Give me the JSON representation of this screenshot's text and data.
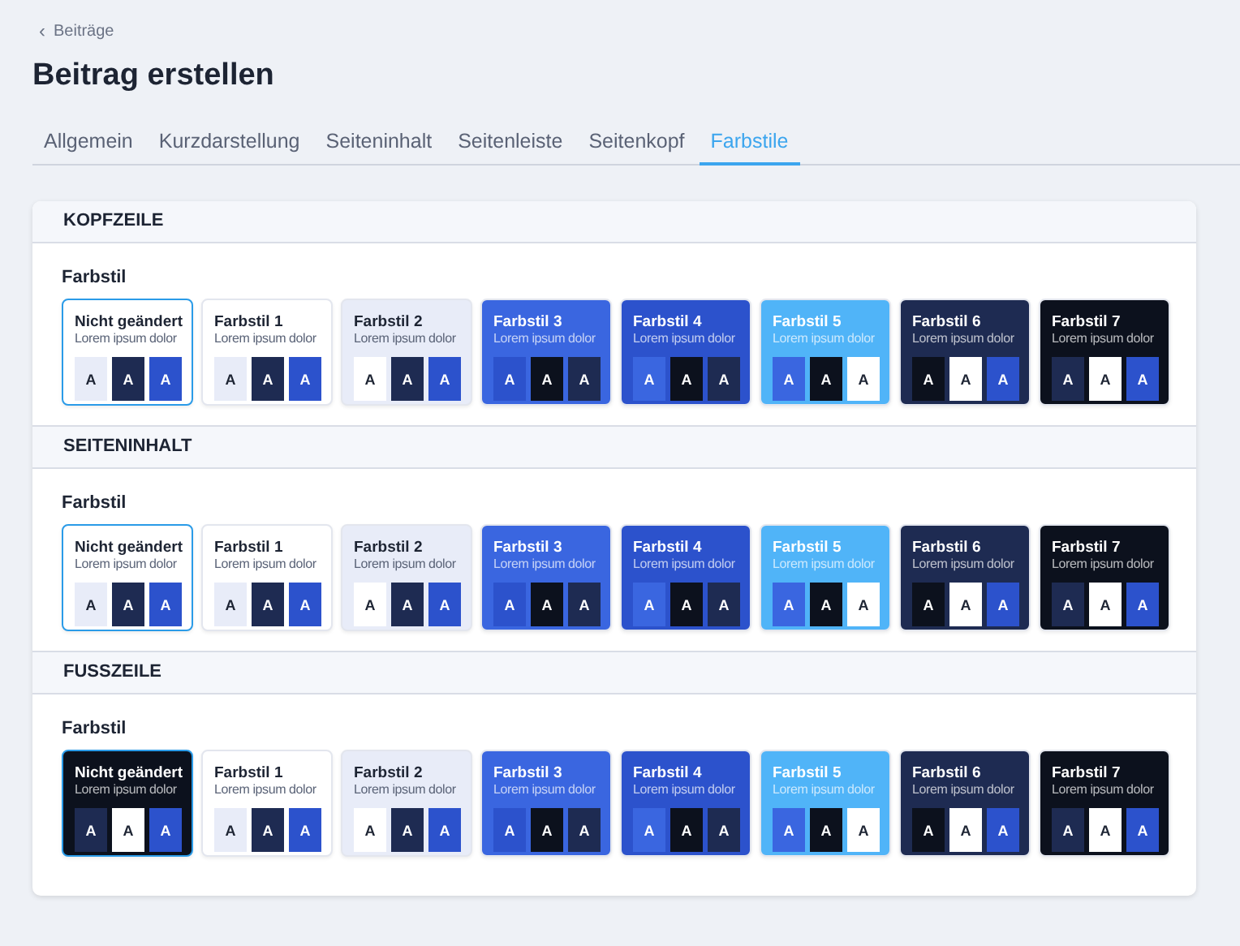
{
  "breadcrumb": {
    "icon": "‹",
    "label": "Beiträge"
  },
  "title": "Beitrag erstellen",
  "tabs": [
    {
      "label": "Allgemein",
      "selected": false
    },
    {
      "label": "Kurzdarstellung",
      "selected": false
    },
    {
      "label": "Seiteninhalt",
      "selected": false
    },
    {
      "label": "Seitenleiste",
      "selected": false
    },
    {
      "label": "Seitenkopf",
      "selected": false
    },
    {
      "label": "Farbstile",
      "selected": true
    }
  ],
  "sections": [
    {
      "title": "KOPFZEILE",
      "field_label": "Farbstil",
      "styles": [
        {
          "name": "Nicht geändert",
          "subtitle": "Lorem ipsum dolor",
          "color": "#ffffff",
          "selected": true,
          "swatches": [
            {
              "label": "A",
              "color": "#e8ecf8"
            },
            {
              "label": "A",
              "color": "#1e2b52"
            },
            {
              "label": "A",
              "color": "#2c52cc"
            }
          ]
        },
        {
          "name": "Farbstil 1",
          "subtitle": "Lorem ipsum dolor",
          "color": "#ffffff",
          "selected": false,
          "swatches": [
            {
              "label": "A",
              "color": "#e8ecf8"
            },
            {
              "label": "A",
              "color": "#1e2b52"
            },
            {
              "label": "A",
              "color": "#2c52cc"
            }
          ]
        },
        {
          "name": "Farbstil 2",
          "subtitle": "Lorem ipsum dolor",
          "color": "#e8ecf8",
          "selected": false,
          "swatches": [
            {
              "label": "A",
              "color": "#ffffff"
            },
            {
              "label": "A",
              "color": "#1e2b52"
            },
            {
              "label": "A",
              "color": "#2c52cc"
            }
          ]
        },
        {
          "name": "Farbstil 3",
          "subtitle": "Lorem ipsum dolor",
          "color": "#3a66e0",
          "selected": false,
          "swatches": [
            {
              "label": "A",
              "color": "#2c52cc"
            },
            {
              "label": "A",
              "color": "#0c111d"
            },
            {
              "label": "A",
              "color": "#1e2b52"
            }
          ]
        },
        {
          "name": "Farbstil 4",
          "subtitle": "Lorem ipsum dolor",
          "color": "#2c52cc",
          "selected": false,
          "swatches": [
            {
              "label": "A",
              "color": "#3a66e0"
            },
            {
              "label": "A",
              "color": "#0c111d"
            },
            {
              "label": "A",
              "color": "#1e2b52"
            }
          ]
        },
        {
          "name": "Farbstil 5",
          "subtitle": "Lorem ipsum dolor",
          "color": "#50b4f8",
          "selected": false,
          "swatches": [
            {
              "label": "A",
              "color": "#3a66e0"
            },
            {
              "label": "A",
              "color": "#0c111d"
            },
            {
              "label": "A",
              "color": "#ffffff"
            }
          ]
        },
        {
          "name": "Farbstil 6",
          "subtitle": "Lorem ipsum dolor",
          "color": "#1e2b52",
          "selected": false,
          "swatches": [
            {
              "label": "A",
              "color": "#0c111d"
            },
            {
              "label": "A",
              "color": "#ffffff"
            },
            {
              "label": "A",
              "color": "#2c52cc"
            }
          ]
        },
        {
          "name": "Farbstil 7",
          "subtitle": "Lorem ipsum dolor",
          "color": "#0c111d",
          "selected": false,
          "swatches": [
            {
              "label": "A",
              "color": "#1e2b52"
            },
            {
              "label": "A",
              "color": "#ffffff"
            },
            {
              "label": "A",
              "color": "#2c52cc"
            }
          ]
        }
      ]
    },
    {
      "title": "SEITENINHALT",
      "field_label": "Farbstil",
      "styles": [
        {
          "name": "Nicht geändert",
          "subtitle": "Lorem ipsum dolor",
          "color": "#ffffff",
          "selected": true,
          "swatches": [
            {
              "label": "A",
              "color": "#e8ecf8"
            },
            {
              "label": "A",
              "color": "#1e2b52"
            },
            {
              "label": "A",
              "color": "#2c52cc"
            }
          ]
        },
        {
          "name": "Farbstil 1",
          "subtitle": "Lorem ipsum dolor",
          "color": "#ffffff",
          "selected": false,
          "swatches": [
            {
              "label": "A",
              "color": "#e8ecf8"
            },
            {
              "label": "A",
              "color": "#1e2b52"
            },
            {
              "label": "A",
              "color": "#2c52cc"
            }
          ]
        },
        {
          "name": "Farbstil 2",
          "subtitle": "Lorem ipsum dolor",
          "color": "#e8ecf8",
          "selected": false,
          "swatches": [
            {
              "label": "A",
              "color": "#ffffff"
            },
            {
              "label": "A",
              "color": "#1e2b52"
            },
            {
              "label": "A",
              "color": "#2c52cc"
            }
          ]
        },
        {
          "name": "Farbstil 3",
          "subtitle": "Lorem ipsum dolor",
          "color": "#3a66e0",
          "selected": false,
          "swatches": [
            {
              "label": "A",
              "color": "#2c52cc"
            },
            {
              "label": "A",
              "color": "#0c111d"
            },
            {
              "label": "A",
              "color": "#1e2b52"
            }
          ]
        },
        {
          "name": "Farbstil 4",
          "subtitle": "Lorem ipsum dolor",
          "color": "#2c52cc",
          "selected": false,
          "swatches": [
            {
              "label": "A",
              "color": "#3a66e0"
            },
            {
              "label": "A",
              "color": "#0c111d"
            },
            {
              "label": "A",
              "color": "#1e2b52"
            }
          ]
        },
        {
          "name": "Farbstil 5",
          "subtitle": "Lorem ipsum dolor",
          "color": "#50b4f8",
          "selected": false,
          "swatches": [
            {
              "label": "A",
              "color": "#3a66e0"
            },
            {
              "label": "A",
              "color": "#0c111d"
            },
            {
              "label": "A",
              "color": "#ffffff"
            }
          ]
        },
        {
          "name": "Farbstil 6",
          "subtitle": "Lorem ipsum dolor",
          "color": "#1e2b52",
          "selected": false,
          "swatches": [
            {
              "label": "A",
              "color": "#0c111d"
            },
            {
              "label": "A",
              "color": "#ffffff"
            },
            {
              "label": "A",
              "color": "#2c52cc"
            }
          ]
        },
        {
          "name": "Farbstil 7",
          "subtitle": "Lorem ipsum dolor",
          "color": "#0c111d",
          "selected": false,
          "swatches": [
            {
              "label": "A",
              "color": "#1e2b52"
            },
            {
              "label": "A",
              "color": "#ffffff"
            },
            {
              "label": "A",
              "color": "#2c52cc"
            }
          ]
        }
      ]
    },
    {
      "title": "FUSSZEILE",
      "field_label": "Farbstil",
      "styles": [
        {
          "name": "Nicht geändert",
          "subtitle": "Lorem ipsum dolor",
          "color": "#0c111d",
          "selected": true,
          "swatches": [
            {
              "label": "A",
              "color": "#1e2b52"
            },
            {
              "label": "A",
              "color": "#ffffff"
            },
            {
              "label": "A",
              "color": "#2c52cc"
            }
          ]
        },
        {
          "name": "Farbstil 1",
          "subtitle": "Lorem ipsum dolor",
          "color": "#ffffff",
          "selected": false,
          "swatches": [
            {
              "label": "A",
              "color": "#e8ecf8"
            },
            {
              "label": "A",
              "color": "#1e2b52"
            },
            {
              "label": "A",
              "color": "#2c52cc"
            }
          ]
        },
        {
          "name": "Farbstil 2",
          "subtitle": "Lorem ipsum dolor",
          "color": "#e8ecf8",
          "selected": false,
          "swatches": [
            {
              "label": "A",
              "color": "#ffffff"
            },
            {
              "label": "A",
              "color": "#1e2b52"
            },
            {
              "label": "A",
              "color": "#2c52cc"
            }
          ]
        },
        {
          "name": "Farbstil 3",
          "subtitle": "Lorem ipsum dolor",
          "color": "#3a66e0",
          "selected": false,
          "swatches": [
            {
              "label": "A",
              "color": "#2c52cc"
            },
            {
              "label": "A",
              "color": "#0c111d"
            },
            {
              "label": "A",
              "color": "#1e2b52"
            }
          ]
        },
        {
          "name": "Farbstil 4",
          "subtitle": "Lorem ipsum dolor",
          "color": "#2c52cc",
          "selected": false,
          "swatches": [
            {
              "label": "A",
              "color": "#3a66e0"
            },
            {
              "label": "A",
              "color": "#0c111d"
            },
            {
              "label": "A",
              "color": "#1e2b52"
            }
          ]
        },
        {
          "name": "Farbstil 5",
          "subtitle": "Lorem ipsum dolor",
          "color": "#50b4f8",
          "selected": false,
          "swatches": [
            {
              "label": "A",
              "color": "#3a66e0"
            },
            {
              "label": "A",
              "color": "#0c111d"
            },
            {
              "label": "A",
              "color": "#ffffff"
            }
          ]
        },
        {
          "name": "Farbstil 6",
          "subtitle": "Lorem ipsum dolor",
          "color": "#1e2b52",
          "selected": false,
          "swatches": [
            {
              "label": "A",
              "color": "#0c111d"
            },
            {
              "label": "A",
              "color": "#ffffff"
            },
            {
              "label": "A",
              "color": "#2c52cc"
            }
          ]
        },
        {
          "name": "Farbstil 7",
          "subtitle": "Lorem ipsum dolor",
          "color": "#0c111d",
          "selected": false,
          "swatches": [
            {
              "label": "A",
              "color": "#1e2b52"
            },
            {
              "label": "A",
              "color": "#ffffff"
            },
            {
              "label": "A",
              "color": "#2c52cc"
            }
          ]
        }
      ]
    }
  ]
}
